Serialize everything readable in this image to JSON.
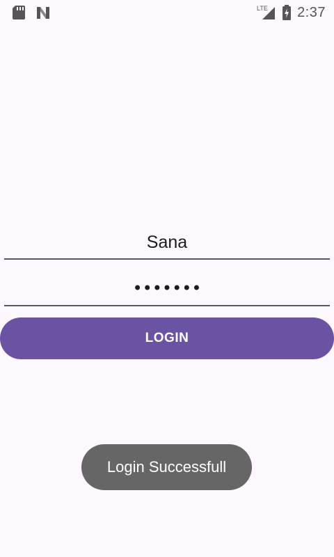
{
  "status_bar": {
    "time": "2:37",
    "network_label": "LTE",
    "left_icons": [
      "sd-card-icon",
      "n-logo-icon"
    ],
    "right_icons": [
      "lte-signal-icon",
      "battery-charging-icon"
    ]
  },
  "login_form": {
    "username_value": "Sana",
    "password_masked": "•••••••",
    "login_label": "LOGIN"
  },
  "toast": {
    "message": "Login Successfull"
  },
  "colors": {
    "background": "#fdf8fd",
    "accent": "#6b53a4",
    "toast_bg": "#666666",
    "underline": "#5b5560"
  }
}
